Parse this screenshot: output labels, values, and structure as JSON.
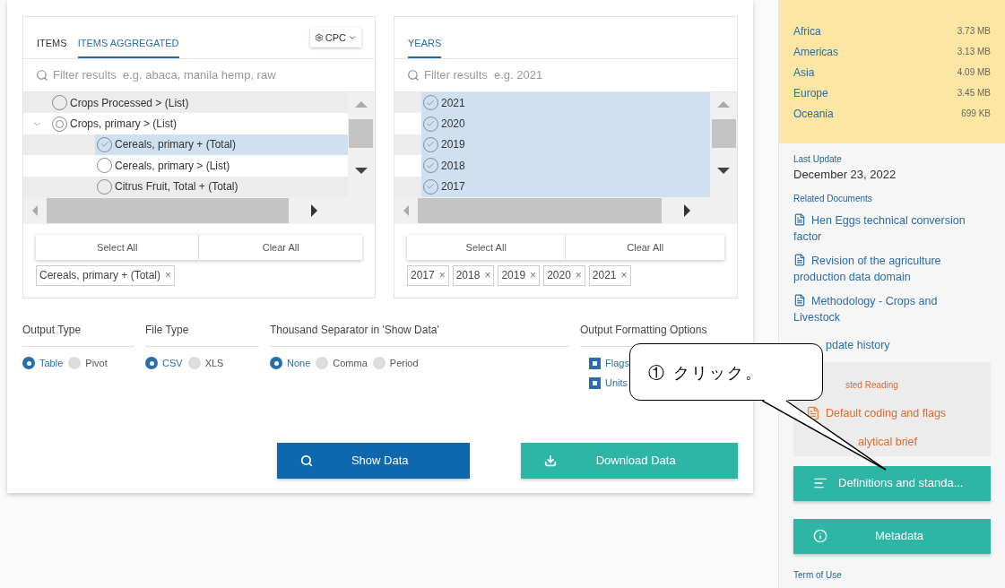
{
  "items_panel": {
    "tabs": [
      {
        "label": "ITEMS",
        "selected": false
      },
      {
        "label": "ITEMS AGGREGATED",
        "selected": true
      }
    ],
    "code_menu": "CPC",
    "filter": {
      "placeholder": "Filter results  e.g. abaca, manila hemp, raw"
    },
    "tree": [
      {
        "label": "Crops Processed > (List)",
        "selected": false,
        "partial": false
      },
      {
        "label": "Crops, primary > (List)",
        "selected": false,
        "partial": true,
        "expanded": true,
        "children": [
          {
            "label": "Cereals, primary + (Total)",
            "selected": true,
            "partial": false
          },
          {
            "label": "Cereals, primary > (List)",
            "selected": false,
            "partial": false
          },
          {
            "label": "Citrus Fruit, Total + (Total)",
            "selected": false,
            "partial": false
          }
        ]
      }
    ],
    "buttons": [
      "Select All",
      "Clear All"
    ],
    "chips": [
      "Cereals, primary + (Total)"
    ],
    "remove_mark": "×"
  },
  "years_panel": {
    "tabs": [
      {
        "label": "YEARS",
        "selected": true
      }
    ],
    "filter": {
      "placeholder": "Filter results  e.g. 2021"
    },
    "list": [
      {
        "label": "2021",
        "selected": true
      },
      {
        "label": "2020",
        "selected": true
      },
      {
        "label": "2019",
        "selected": true
      },
      {
        "label": "2018",
        "selected": true
      },
      {
        "label": "2017",
        "selected": true
      }
    ],
    "buttons": [
      "Select All",
      "Clear All"
    ],
    "chips": [
      "2017",
      "2018",
      "2019",
      "2020",
      "2021"
    ],
    "remove_mark": "×"
  },
  "options": [
    {
      "title": "Output Type",
      "kind": "radio",
      "choices": [
        {
          "label": "Table",
          "selected": true
        },
        {
          "label": "Pivot",
          "selected": false
        }
      ]
    },
    {
      "title": "File Type",
      "kind": "radio",
      "choices": [
        {
          "label": "CSV",
          "selected": true
        },
        {
          "label": "XLS",
          "selected": false
        }
      ]
    },
    {
      "title": "Thousand Separator in 'Show Data'",
      "kind": "radio",
      "choices": [
        {
          "label": "None",
          "selected": true
        },
        {
          "label": "Comma",
          "selected": false
        },
        {
          "label": "Period",
          "selected": false
        }
      ]
    },
    {
      "title": "Output Formatting Options",
      "kind": "checkbox",
      "choices": [
        {
          "label": "Flags",
          "checked": true
        },
        {
          "label": "Units",
          "checked": true
        }
      ]
    }
  ],
  "actions": [
    {
      "label": "Show Data",
      "kind": "search"
    },
    {
      "label": "Download Data",
      "kind": "download"
    }
  ],
  "sidebar": {
    "downloads": [
      {
        "name": "Africa",
        "size": "3.73 MB"
      },
      {
        "name": "Americas",
        "size": "3.13 MB"
      },
      {
        "name": "Asia",
        "size": "4.09 MB"
      },
      {
        "name": "Europe",
        "size": "3.45 MB"
      },
      {
        "name": "Oceania",
        "size": "699 KB"
      }
    ],
    "last_update": {
      "label": "Last Update",
      "value": "December 23, 2022"
    },
    "related": {
      "label": "Related Documents",
      "docs": [
        "Hen Eggs technical conversion factor",
        "Revision of the agriculture production data domain",
        "Methodology - Crops and Livestock"
      ],
      "partial_doc": "pdate history"
    },
    "suggested": {
      "label": "sted Reading",
      "items": [
        "Default coding and flags",
        "alytical brief"
      ]
    },
    "buttons": [
      {
        "label": "Definitions and standa...",
        "kind": "list"
      },
      {
        "label": "Metadata",
        "kind": "info"
      }
    ],
    "terms_label": "Term of Use"
  },
  "callout": {
    "text": "① クリック。"
  }
}
